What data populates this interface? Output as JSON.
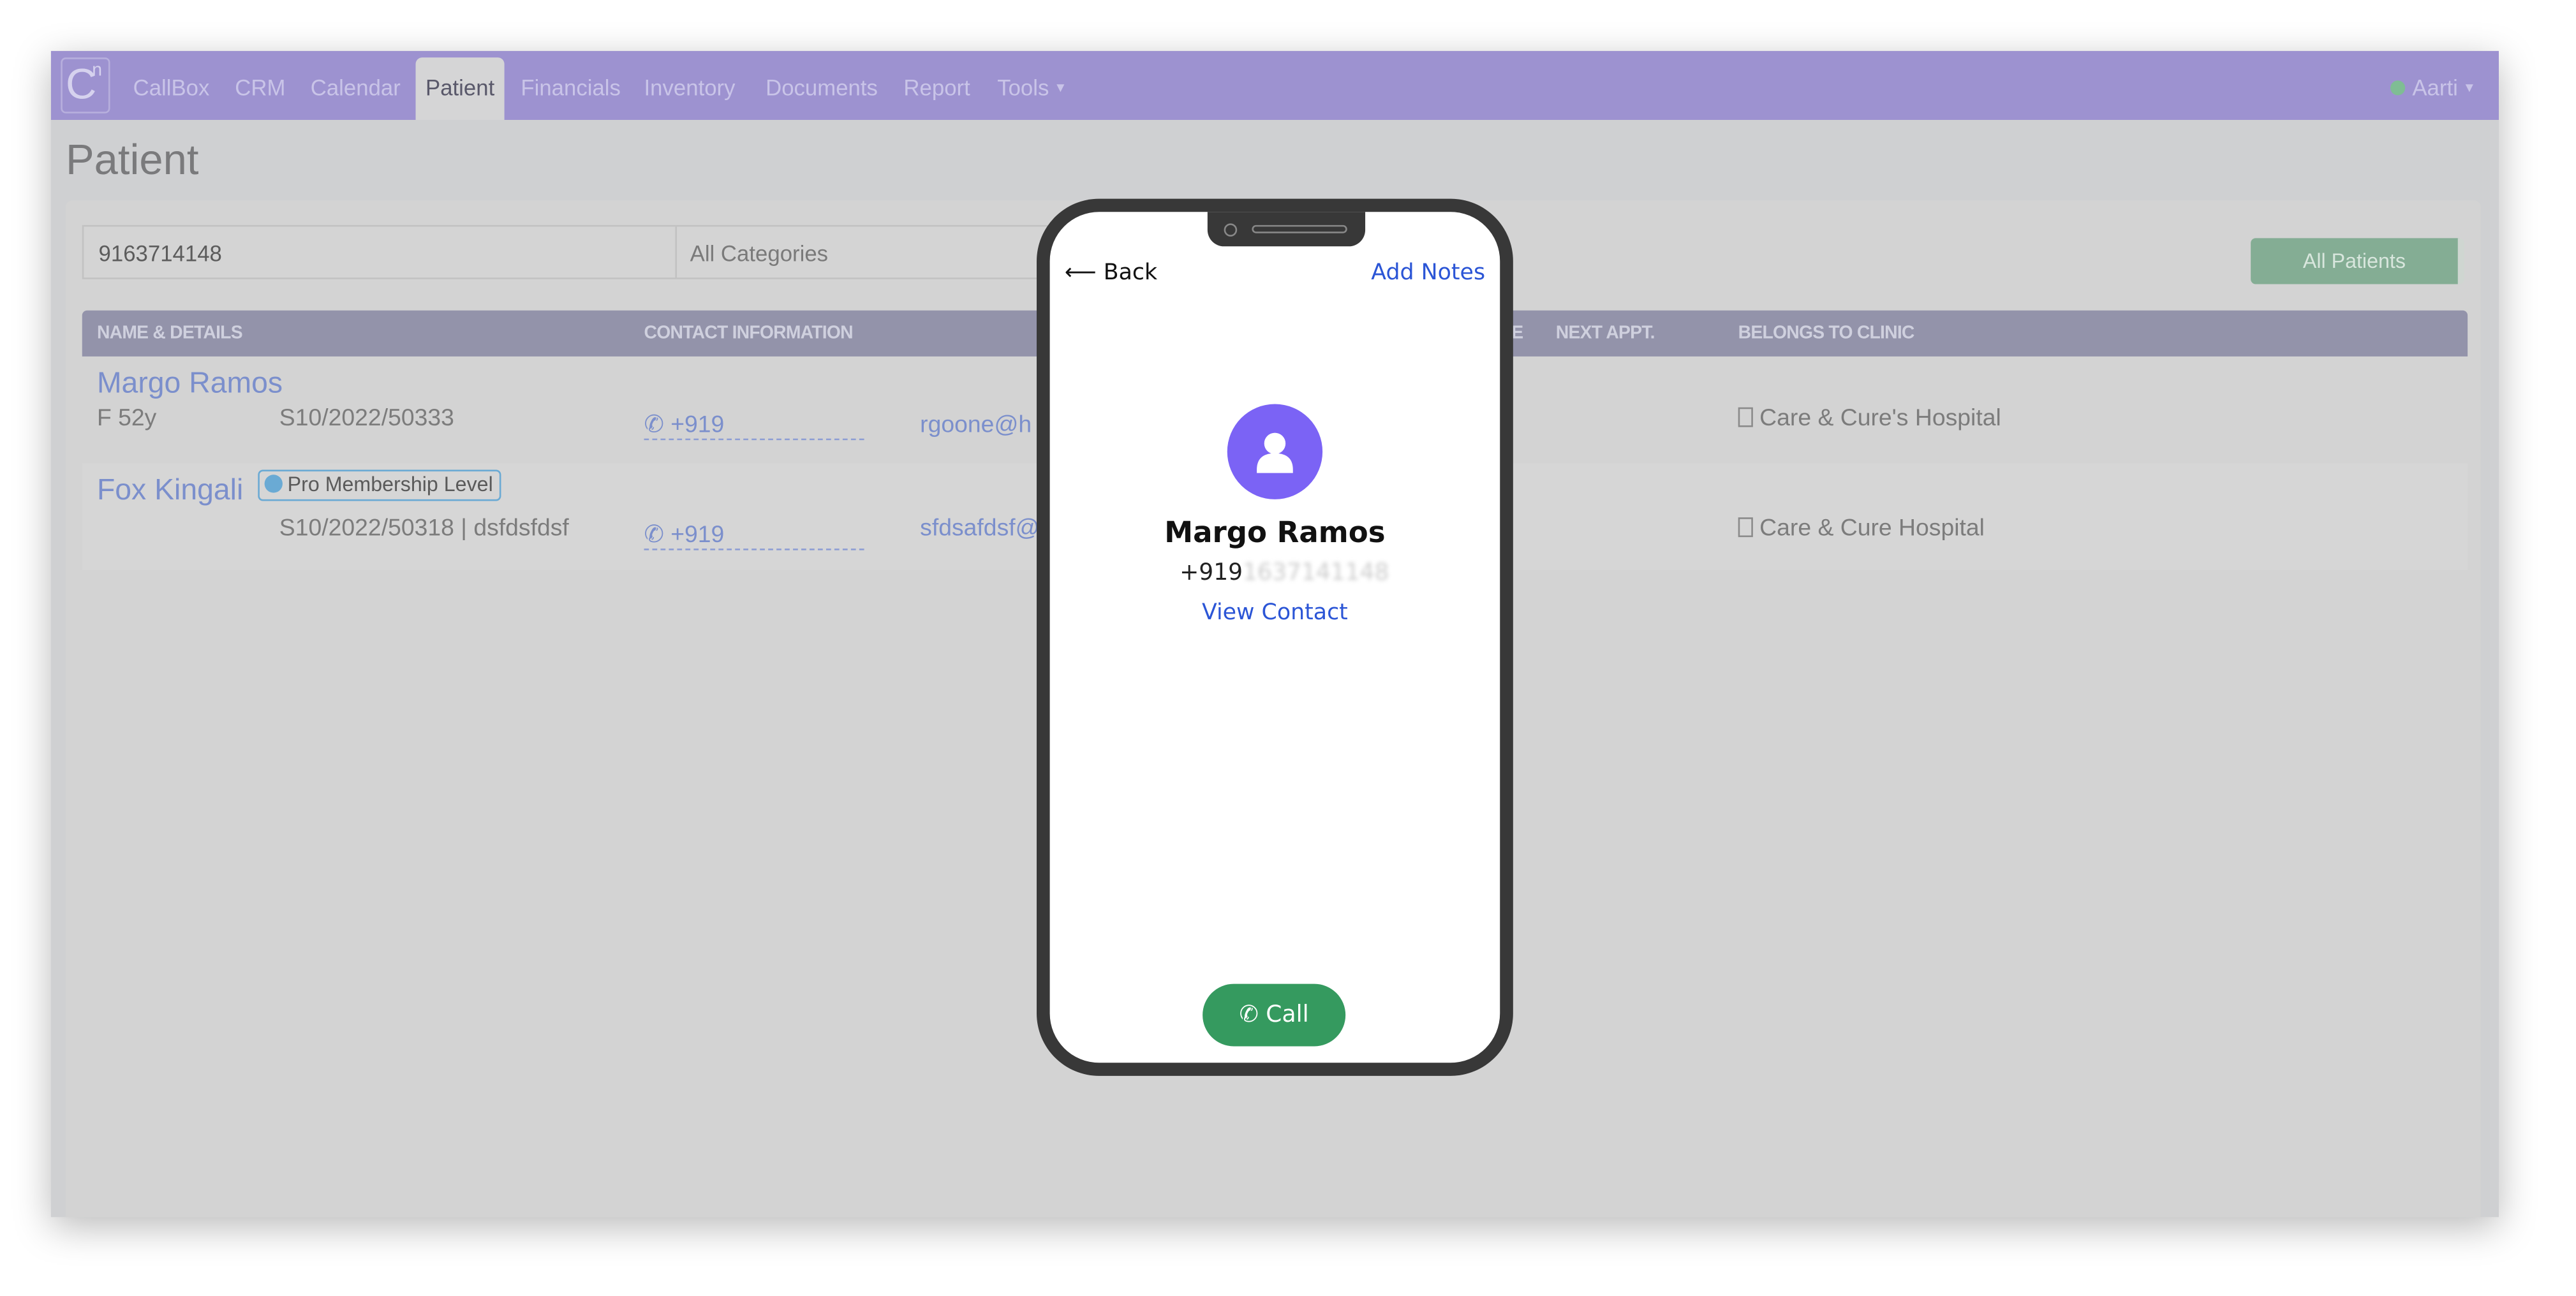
{
  "nav": {
    "logo": "C",
    "logo_sup": "n",
    "items": [
      "CallBox",
      "CRM",
      "Calendar",
      "Patient",
      "Financials",
      "Inventory",
      "Documents",
      "Report",
      "Tools"
    ],
    "active": "Patient",
    "user": "Aarti",
    "status_color": "#7fbd94"
  },
  "page": {
    "title": "Patient"
  },
  "filters": {
    "search_value": "9163714148",
    "category": "All Categories",
    "all_patients": "All Patients"
  },
  "table": {
    "headers": [
      "NAME & DETAILS",
      "CONTACT INFORMATION",
      "E",
      "NEXT APPT.",
      "BELONGS TO CLINIC"
    ],
    "rows": [
      {
        "name": "Margo Ramos",
        "gender_age": "F 52y",
        "id": "S10/2022/50333",
        "phone": "+919",
        "email": "rgoone@h",
        "clinic": "Care & Cure's Hospital"
      },
      {
        "name": "Fox Kingali",
        "badge": "Pro Membership Level",
        "id": "S10/2022/50318 | dsfdsfdsf",
        "phone": "+919",
        "email": "sfdsafdsf@",
        "clinic": "Care & Cure Hospital"
      }
    ]
  },
  "phone_modal": {
    "back": "Back",
    "add_notes": "Add Notes",
    "contact_name": "Margo Ramos",
    "contact_number_visible": "+919",
    "contact_number_blurred": "1637141148",
    "view_contact": "View Contact",
    "call": "Call",
    "avatar_color": "#7b63f5",
    "call_color": "#359a5f"
  }
}
